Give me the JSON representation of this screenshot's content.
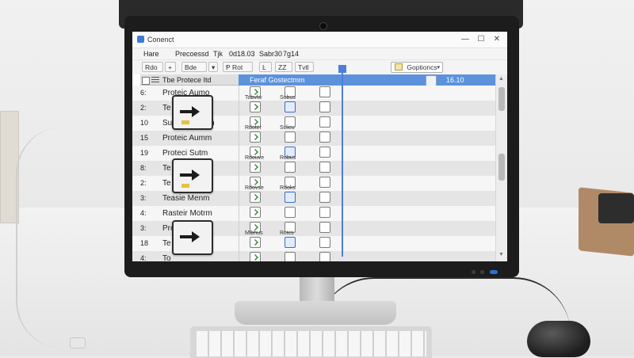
{
  "window": {
    "title": "Conenct",
    "controls": [
      "—",
      "☐",
      "✕"
    ]
  },
  "menu": [
    "Hare",
    "Precoessd",
    "Tjk",
    "0d18.03",
    "Sabr30",
    "7g14"
  ],
  "toolbar": {
    "buttons": [
      "Rdo",
      "+",
      "Bde",
      "▾",
      "Ᵽ Rot",
      "Ŀ",
      "ZZ",
      "Tvtl"
    ],
    "dropdown_value": "Goptioncs"
  },
  "grid": {
    "left_header": "Tbe Protece Itd",
    "right_header": "Feraf Gostectmm",
    "playhead_time": "16.10",
    "rows": [
      {
        "num": "6:",
        "name": "Proteic Aumo",
        "labels": [
          "Tobvlw",
          "Sobus"
        ]
      },
      {
        "num": "2:",
        "name": "Te",
        "labels": [
          "",
          ""
        ]
      },
      {
        "num": "10",
        "name": "Suphec Uumin",
        "labels": [
          "Rdoter",
          "Sclicu"
        ]
      },
      {
        "num": "15",
        "name": "Proteic Aumm",
        "labels": [
          "",
          ""
        ]
      },
      {
        "num": "19",
        "name": "Proteci Sutm",
        "labels": [
          "Rdouve",
          "Robus"
        ]
      },
      {
        "num": "8:",
        "name": "Te",
        "labels": [
          "",
          ""
        ]
      },
      {
        "num": "2:",
        "name": "Te",
        "labels": [
          "Rdovse",
          "Rdoks"
        ]
      },
      {
        "num": "3:",
        "name": "Teasie Menm",
        "labels": [
          "",
          ""
        ]
      },
      {
        "num": "4:",
        "name": "Rasteir Motrm",
        "labels": [
          "",
          ""
        ]
      },
      {
        "num": "3:",
        "name": "Prote",
        "labels": [
          "Mlbhus",
          "Rctcs"
        ]
      },
      {
        "num": "18",
        "name": "Te",
        "labels": [
          "",
          ""
        ]
      },
      {
        "num": "4:",
        "name": "To",
        "labels": [
          "",
          ""
        ]
      }
    ]
  },
  "colors": {
    "accent": "#5c92dc",
    "playhead": "#4f7ed6",
    "header_gray": "#dfdfdf"
  }
}
